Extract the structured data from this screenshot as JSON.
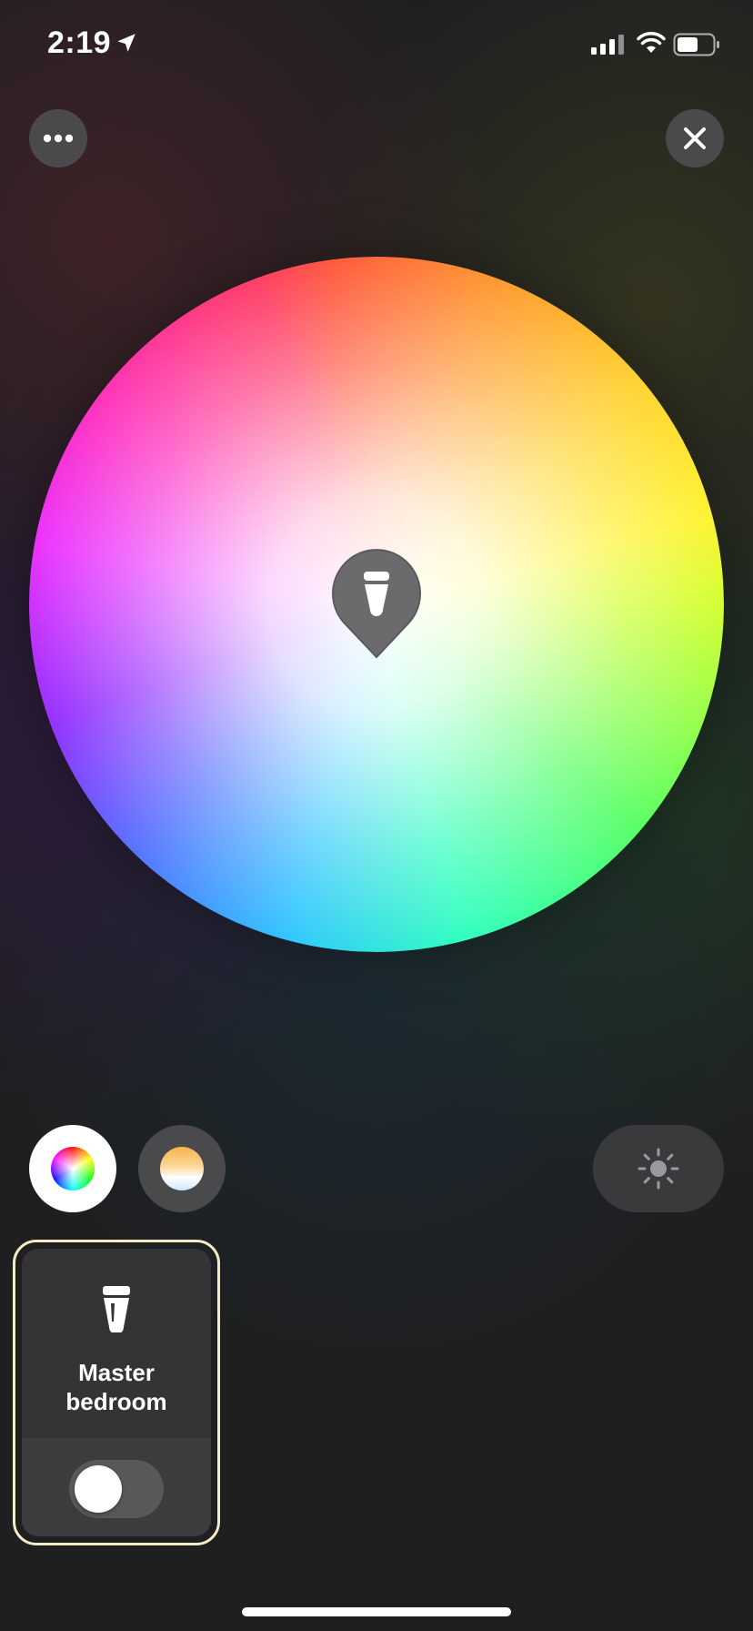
{
  "status_bar": {
    "time": "2:19",
    "location_icon": "location-arrow-icon",
    "signal_icon": "cellular-signal-icon",
    "wifi_icon": "wifi-icon",
    "battery_icon": "battery-icon"
  },
  "header": {
    "more_icon": "more-dots-icon",
    "close_icon": "close-icon"
  },
  "color_picker": {
    "marker_icon": "lightbulb-pin-icon"
  },
  "modes": {
    "color_icon": "color-wheel-icon",
    "white_icon": "white-ambiance-icon",
    "brightness_icon": "sun-icon",
    "selected": "color"
  },
  "light_card": {
    "name": "Master\nbedroom",
    "icon": "bulb-icon",
    "toggle_on": false
  },
  "colors": {
    "background": "#1f1f21",
    "button_bg": "#4a4a4c",
    "card_bg": "#343436",
    "card_outline": "#f4ecc4"
  }
}
